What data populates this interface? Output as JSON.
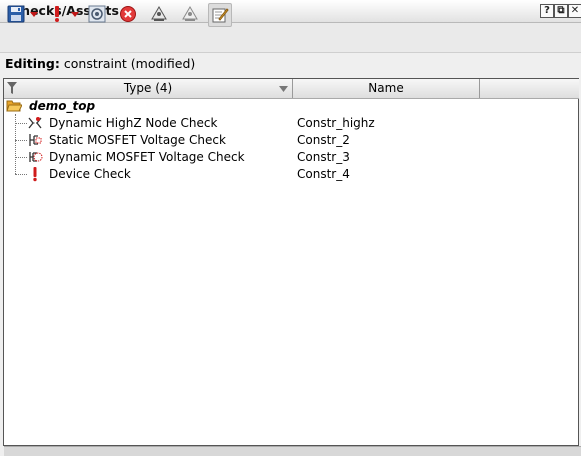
{
  "window": {
    "title": "Checks/Asserts",
    "help_glyph": "?",
    "float_glyph": "⧉",
    "close_glyph": "✕"
  },
  "toolbar": {
    "icons": [
      "save-icon",
      "dropdown-arrow-icon",
      "exclamation-icon",
      "dropdown-arrow-icon",
      "target-icon",
      "stop-icon",
      "up-tree-icon",
      "down-tree-icon",
      "edit-icon"
    ]
  },
  "editing": {
    "label": "Editing:",
    "value": "constraint (modified)"
  },
  "table": {
    "columns": [
      "Type (4)",
      "Name"
    ],
    "root": "demo_top",
    "rows": [
      {
        "type": "Dynamic HighZ Node Check",
        "name": "Constr_highz",
        "icon": "highz-check-icon"
      },
      {
        "type": "Static MOSFET Voltage Check",
        "name": "Constr_2",
        "icon": "static-mosfet-check-icon"
      },
      {
        "type": "Dynamic MOSFET Voltage Check",
        "name": "Constr_3",
        "icon": "dynamic-mosfet-check-icon"
      },
      {
        "type": "Device Check",
        "name": "Constr_4",
        "icon": "device-check-icon"
      }
    ]
  },
  "colors": {
    "accent_red": "#c01818",
    "folder": "#f2b23c"
  }
}
